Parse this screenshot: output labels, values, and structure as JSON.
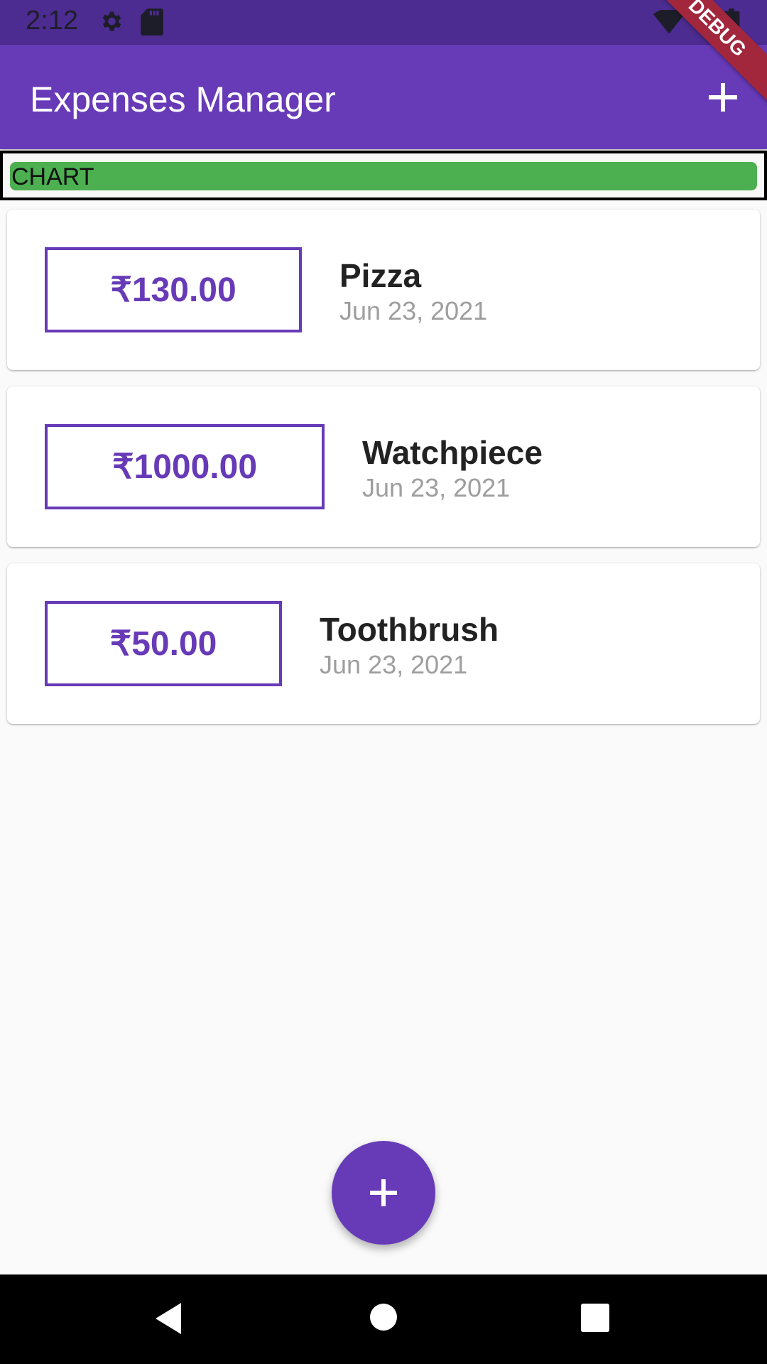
{
  "status_bar": {
    "time": "2:12",
    "icons": [
      "gear-icon",
      "sd-card-icon",
      "wifi-icon",
      "battery-icon"
    ]
  },
  "app_bar": {
    "title": "Expenses Manager",
    "add_icon": "plus-icon",
    "color": "#673ab7",
    "debug_ribbon": "DEBUG"
  },
  "chart": {
    "label": "CHART",
    "bar_color": "#4caf50"
  },
  "transactions": [
    {
      "amount": "₹130.00",
      "title": "Pizza",
      "date": "Jun 23, 2021"
    },
    {
      "amount": "₹1000.00",
      "title": "Watchpiece",
      "date": "Jun 23, 2021"
    },
    {
      "amount": "₹50.00",
      "title": "Toothbrush",
      "date": "Jun 23, 2021"
    }
  ],
  "fab": {
    "icon": "plus-icon"
  },
  "nav_bar": {
    "icons": [
      "back-icon",
      "home-icon",
      "recents-icon"
    ]
  }
}
